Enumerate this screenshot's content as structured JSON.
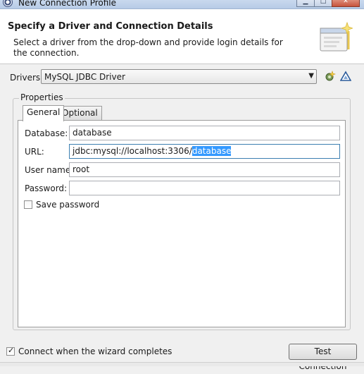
{
  "window": {
    "title": "New Connection Profile",
    "buttons": [
      "minimize",
      "maximize",
      "close"
    ]
  },
  "banner": {
    "title": "Specify a Driver and Connection Details",
    "description": "Select a driver from the drop-down and provide login details for the connection.",
    "graphic_icon": "wizard-banner-icon"
  },
  "driver": {
    "label": "Drivers:",
    "selected": "MySQL JDBC Driver",
    "new_driver_icon": "new-driver-icon",
    "edit_driver_icon": "edit-driver-icon"
  },
  "properties": {
    "group_label": "Properties",
    "tabs": [
      {
        "label": "General",
        "active": true
      },
      {
        "label": "Optional",
        "active": false
      }
    ],
    "fields": {
      "database": {
        "label": "Database:",
        "value": "database"
      },
      "url": {
        "label": "URL:",
        "value_prefix": "jdbc:mysql://localhost:3306/",
        "value_selected": "database"
      },
      "user": {
        "label": "User name:",
        "value": "root"
      },
      "password": {
        "label": "Password:",
        "value": ""
      }
    },
    "save_password": {
      "label": "Save password",
      "checked": false
    }
  },
  "footer": {
    "connect_when_complete": {
      "label": "Connect when the wizard completes",
      "checked": true
    },
    "test_connection_label": "Test Connection"
  },
  "colors": {
    "selection": "#3399ff",
    "titlebar": "#c9d9ee"
  }
}
